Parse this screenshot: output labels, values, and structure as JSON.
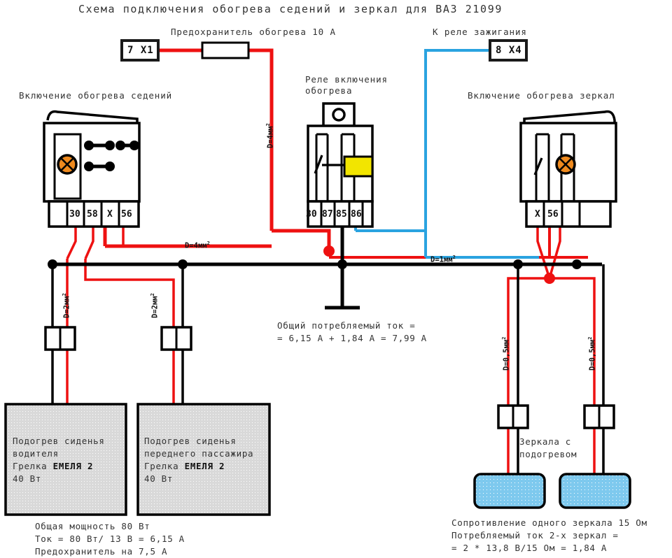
{
  "title": "Схема подключения обогрева седений и зеркал для ВАЗ 21099",
  "labels": {
    "fuse_heading": "Предохранитель обогрева 10 А",
    "ignition_relay_heading": "К реле зажигания",
    "seat_switch_heading": "Включение обогрева седений",
    "relay_heading_line1": "Реле включения",
    "relay_heading_line2": "обогрева",
    "mirror_switch_heading": "Включение обогрева зеркал",
    "mirrors_line1": "Зеркала с",
    "mirrors_line2": "подогревом"
  },
  "connectors": {
    "left": "7 X1",
    "right": "8 X4"
  },
  "terminals": {
    "seat_switch": [
      "30",
      "58",
      "X",
      "56"
    ],
    "relay": [
      "30",
      "87",
      "85",
      "86"
    ],
    "mirror_switch": [
      "X",
      "56"
    ]
  },
  "gauges": {
    "vertical_fuse": "D=4мм",
    "horizontal_main": "D=4мм",
    "horizontal_thin": "D=1мм",
    "seat_left": "D=2мм",
    "seat_right": "D=2мм",
    "mirror_left": "D=0,5мм",
    "mirror_right": "D=0,5мм",
    "superscript": "2"
  },
  "notes": {
    "total_current_line1": "Общий потребляемый ток =",
    "total_current_line2": "= 6,15 А + 1,84 А = 7,99 А",
    "power_line1": "Общая мощность 80 Вт",
    "power_line2": "Ток = 80 Вт/ 13 В = 6,15 А",
    "power_line3": "Предохранитель на 7,5 А",
    "mirror_line1": "Сопротивление одного зеркала 15 Ом",
    "mirror_line2": "Потребляемый ток 2-х зеркал =",
    "mirror_line3": "= 2 * 13,8 В/15 Ом = 1,84 А"
  },
  "loads": {
    "driver_seat": {
      "line1": "Подогрев сиденья",
      "line2": "водителя",
      "line3_prefix": "Грелка ",
      "line3_brand": "ЕМЕЛЯ 2",
      "line4": "40 Вт"
    },
    "passenger_seat": {
      "line1": "Подогрев сиденья",
      "line2": "переднего пассажира",
      "line3_prefix": "Грелка ",
      "line3_brand": "ЕМЕЛЯ 2",
      "line4": "40 Вт"
    }
  },
  "colors": {
    "wire_power": "#ee1111",
    "wire_ground": "#000000",
    "wire_ignition": "#2aa3e0",
    "mirror_fill": "#7ec9ee",
    "load_fill": "#d9d9d9",
    "lamp_fill": "#ef8a1e",
    "relay_coil_fill": "#f2e500"
  }
}
